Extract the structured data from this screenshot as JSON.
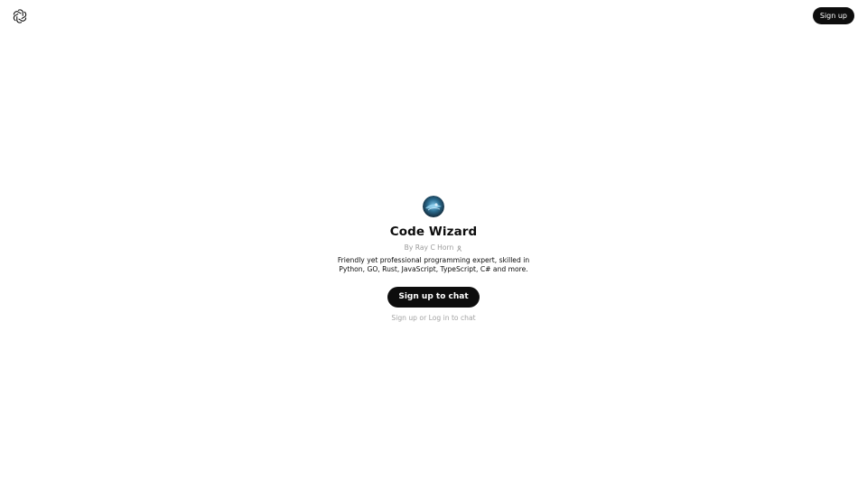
{
  "header": {
    "logo_icon": "openai-knot-icon",
    "signup_label": "Sign up"
  },
  "gpt": {
    "avatar_icon": "code-wizard-avatar",
    "title": "Code Wizard",
    "author": "By Ray C Horn",
    "author_icon": "person-icon",
    "description": "Friendly yet professional programming expert, skilled in Python, GO, Rust, JavaScript, TypeScript, C# and more.",
    "cta_label": "Sign up to chat",
    "footnote": {
      "signup_link": "Sign up",
      "or_text": " or ",
      "login_link": "Log in",
      "suffix_text": " to chat"
    }
  },
  "colors": {
    "button_bg": "#0d0d0d",
    "button_text": "#ffffff",
    "muted_text": "#9b9b9b"
  }
}
